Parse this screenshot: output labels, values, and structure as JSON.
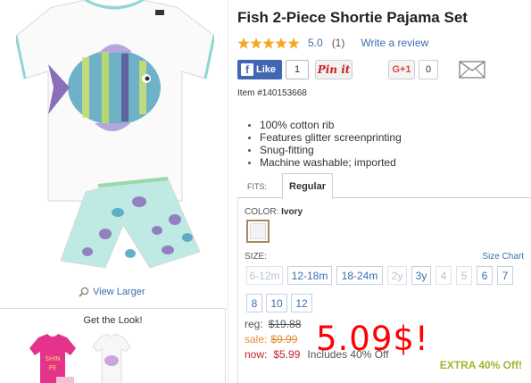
{
  "product": {
    "title": "Fish 2-Piece Shortie Pajama Set",
    "rating_value": "5.0",
    "review_count": "(1)",
    "write_review": "Write a review",
    "item_number": "Item #140153668",
    "features": [
      "100% cotton rib",
      "Features glitter screenprinting",
      "Snug-fitting",
      "Machine washable; imported"
    ]
  },
  "social": {
    "like_label": "Like",
    "like_count": "1",
    "pin_label": "Pin it",
    "gplus_label": "G+1",
    "gplus_count": "0",
    "icons": [
      "facebook-icon",
      "pinterest-icon",
      "google-plus-icon",
      "email-icon"
    ]
  },
  "fits": {
    "label": "FITS:",
    "selected": "Regular"
  },
  "color": {
    "label": "COLOR:",
    "value": "Ivory",
    "swatch_hex": "#f3f3f3"
  },
  "size": {
    "label": "SIZE:",
    "chart_link": "Size Chart",
    "options": [
      {
        "label": "6-12m",
        "available": false
      },
      {
        "label": "12-18m",
        "available": true
      },
      {
        "label": "18-24m",
        "available": true
      },
      {
        "label": "2y",
        "available": false
      },
      {
        "label": "3y",
        "available": true
      },
      {
        "label": "4",
        "available": false
      },
      {
        "label": "5",
        "available": false
      },
      {
        "label": "6",
        "available": true
      },
      {
        "label": "7",
        "available": true
      },
      {
        "label": "8",
        "available": true
      },
      {
        "label": "10",
        "available": true
      },
      {
        "label": "12",
        "available": true
      }
    ]
  },
  "pricing": {
    "reg_label": "reg:",
    "reg_value": "$19.88",
    "sale_label": "sale:",
    "sale_value": "$9.99",
    "now_label": "now:",
    "now_value": "$5.99",
    "includes_text": "Includes 40% Off",
    "overlay_price": "5.09$!",
    "extra_badge": "EXTRA 40% Off!"
  },
  "left": {
    "view_larger": "View Larger",
    "get_the_look": "Get the Look!"
  },
  "colors": {
    "link": "#3a6fb0",
    "sale": "#e28b2f",
    "now": "#c0272d",
    "overlay": "#ff0000",
    "extra": "#9bb82e",
    "stars": "#f7a823"
  }
}
